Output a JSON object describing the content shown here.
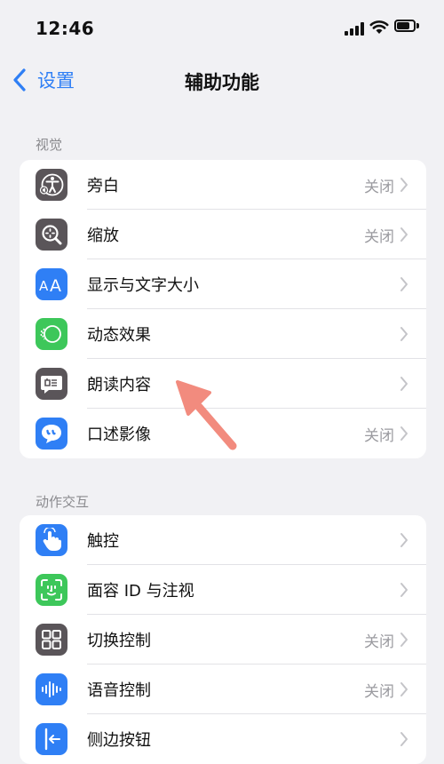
{
  "status_bar": {
    "time": "12:46"
  },
  "nav": {
    "back_label": "设置",
    "title": "辅助功能"
  },
  "sections": [
    {
      "header": "视觉",
      "items": [
        {
          "label": "旁白",
          "value": "关闭",
          "icon": "voiceover-icon",
          "color": "#5a5559"
        },
        {
          "label": "缩放",
          "value": "关闭",
          "icon": "zoom-icon",
          "color": "#5a5559"
        },
        {
          "label": "显示与文字大小",
          "value": "",
          "icon": "text-size-icon",
          "color": "#2f7ff5"
        },
        {
          "label": "动态效果",
          "value": "",
          "icon": "motion-icon",
          "color": "#3dc75a"
        },
        {
          "label": "朗读内容",
          "value": "",
          "icon": "spoken-content-icon",
          "color": "#5a5559"
        },
        {
          "label": "口述影像",
          "value": "关闭",
          "icon": "audio-description-icon",
          "color": "#2f7ff5"
        }
      ]
    },
    {
      "header": "动作交互",
      "items": [
        {
          "label": "触控",
          "value": "",
          "icon": "touch-icon",
          "color": "#2f7ff5"
        },
        {
          "label": "面容 ID 与注视",
          "value": "",
          "icon": "face-id-icon",
          "color": "#3dc75a"
        },
        {
          "label": "切换控制",
          "value": "关闭",
          "icon": "switch-control-icon",
          "color": "#5a5559"
        },
        {
          "label": "语音控制",
          "value": "关闭",
          "icon": "voice-control-icon",
          "color": "#2f7ff5"
        },
        {
          "label": "侧边按钮",
          "value": "",
          "icon": "side-button-icon",
          "color": "#2f7ff5"
        }
      ]
    }
  ],
  "annotation": {
    "icon": "pointer-arrow-icon",
    "color": "#f28b7e"
  }
}
